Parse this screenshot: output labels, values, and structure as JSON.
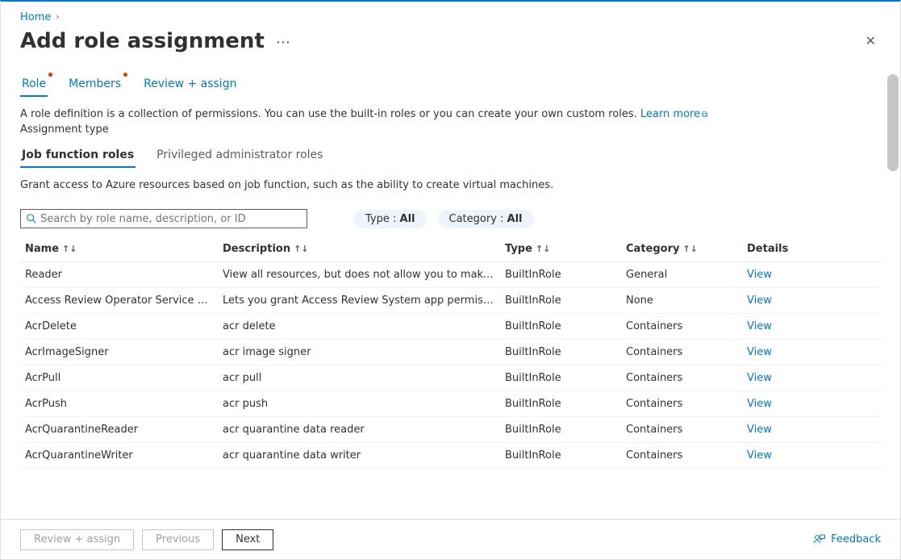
{
  "breadcrumb": {
    "home": "Home"
  },
  "header": {
    "title": "Add role assignment",
    "close_aria": "Close"
  },
  "tabs": [
    {
      "label": "Role",
      "has_dot": true,
      "active": true
    },
    {
      "label": "Members",
      "has_dot": true
    },
    {
      "label": "Review + assign"
    }
  ],
  "help": {
    "text": "A role definition is a collection of permissions. You can use the built-in roles or you can create your own custom roles. ",
    "learn_more": "Learn more",
    "assignment_label": "Assignment type"
  },
  "subtabs": {
    "job": "Job function roles",
    "priv": "Privileged administrator roles"
  },
  "grant_text": "Grant access to Azure resources based on job function, such as the ability to create virtual machines.",
  "search": {
    "placeholder": "Search by role name, description, or ID"
  },
  "filters": {
    "type_label": "Type : ",
    "type_value": "All",
    "category_label": "Category : ",
    "category_value": "All"
  },
  "columns": {
    "name": "Name",
    "description": "Description",
    "type": "Type",
    "category": "Category",
    "details": "Details"
  },
  "sort_glyph": "↑↓",
  "view_label": "View",
  "roles": [
    {
      "name": "Reader",
      "description": "View all resources, but does not allow you to make any ch…",
      "type": "BuiltInRole",
      "category": "General"
    },
    {
      "name": "Access Review Operator Service Role",
      "description": "Lets you grant Access Review System app permissions to …",
      "type": "BuiltInRole",
      "category": "None"
    },
    {
      "name": "AcrDelete",
      "description": "acr delete",
      "type": "BuiltInRole",
      "category": "Containers"
    },
    {
      "name": "AcrImageSigner",
      "description": "acr image signer",
      "type": "BuiltInRole",
      "category": "Containers"
    },
    {
      "name": "AcrPull",
      "description": "acr pull",
      "type": "BuiltInRole",
      "category": "Containers"
    },
    {
      "name": "AcrPush",
      "description": "acr push",
      "type": "BuiltInRole",
      "category": "Containers"
    },
    {
      "name": "AcrQuarantineReader",
      "description": "acr quarantine data reader",
      "type": "BuiltInRole",
      "category": "Containers"
    },
    {
      "name": "AcrQuarantineWriter",
      "description": "acr quarantine data writer",
      "type": "BuiltInRole",
      "category": "Containers"
    }
  ],
  "footer": {
    "review": "Review + assign",
    "previous": "Previous",
    "next": "Next",
    "feedback": "Feedback"
  }
}
